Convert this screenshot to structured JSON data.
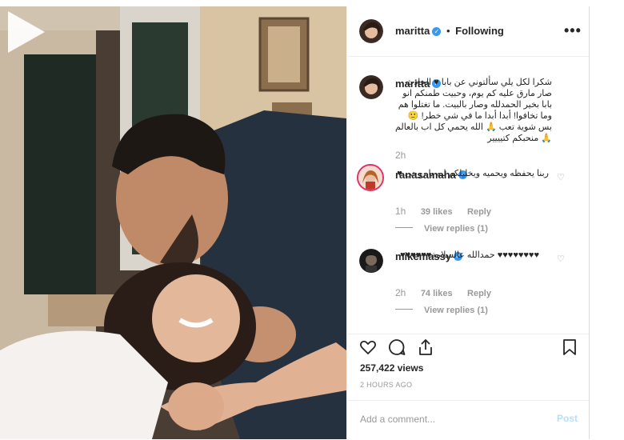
{
  "post": {
    "username": "maritta",
    "separator": "•",
    "follow_status": "Following",
    "more": "•••",
    "caption": "شكرا لكل يلي سألتوني عن بابا ♥ الحادث صار مارق عليه كم يوم، وحبيت طمنكم انو بابا بخير الحمدلله وصار بالبيت. ما تغتلوا هم وما تخافوا! أبدا أبدا ما في شي خطر! 🙂 بس شوية تعب 🙏 الله يحمي كل اب بالعالم 🙏 منحبكم كتيييير",
    "caption_time": "2h"
  },
  "comments": [
    {
      "username": "ranasamaha",
      "text": "ربنا يحفظه ويحميه ويخليلكم ليه يا روحي ♥",
      "time": "1h",
      "likes": "39 likes",
      "reply": "Reply",
      "view_replies": "View replies (1)"
    },
    {
      "username": "mikemassy",
      "text": "♥♥♥♥♥♥♥♥ حمدالله عالسلامة♥♥♥♥♥♥",
      "time": "2h",
      "likes": "74 likes",
      "reply": "Reply",
      "view_replies": "View replies (1)"
    }
  ],
  "stats": {
    "views": "257,422 views",
    "time_ago": "2 HOURS AGO"
  },
  "composer": {
    "placeholder": "Add a comment...",
    "post_label": "Post"
  },
  "colors": {
    "verified": "#3897f0",
    "post_disabled": "#b2dffc",
    "meta_grey": "#999999"
  }
}
